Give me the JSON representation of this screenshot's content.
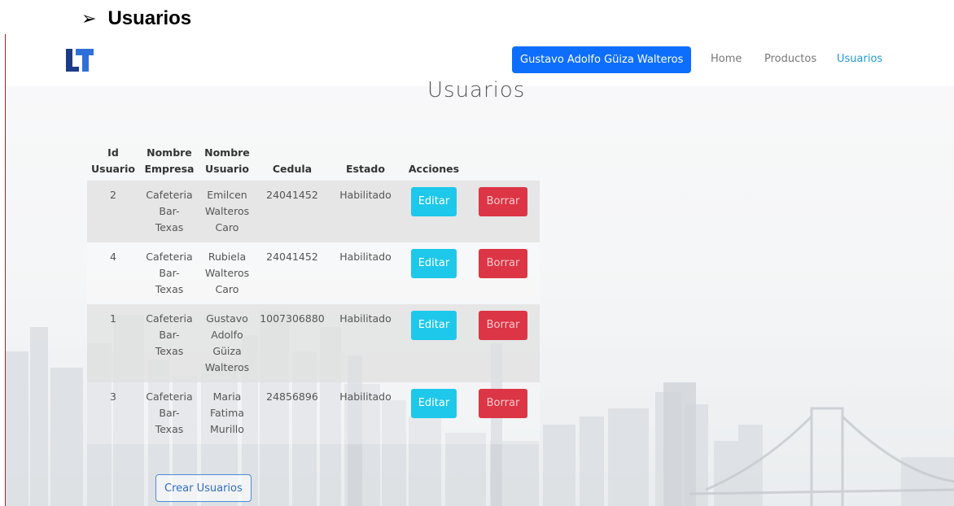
{
  "doc_heading": {
    "bullet": "➢",
    "text": "Usuarios"
  },
  "navbar": {
    "user_button": "Gustavo Adolfo Güiza Walteros",
    "links": [
      "Home",
      "Productos",
      "Usuarios"
    ]
  },
  "page_title": "Usuarios",
  "table": {
    "headers": {
      "id_line1": "Id",
      "id_line2": "Usuario",
      "empresa_line1": "Nombre",
      "empresa_line2": "Empresa",
      "usuario_line1": "Nombre",
      "usuario_line2": "Usuario",
      "cedula": "Cedula",
      "estado": "Estado",
      "acciones": "Acciones"
    },
    "rows": [
      {
        "id": "2",
        "empresa": [
          "Cafeteria",
          "Bar-",
          "Texas"
        ],
        "nombre": [
          "Emilcen",
          "Walteros",
          "Caro"
        ],
        "cedula": "24041452",
        "estado": "Habilitado"
      },
      {
        "id": "4",
        "empresa": [
          "Cafeteria",
          "Bar-",
          "Texas"
        ],
        "nombre": [
          "Rubiela",
          "Walteros",
          "Caro"
        ],
        "cedula": "24041452",
        "estado": "Habilitado"
      },
      {
        "id": "1",
        "empresa": [
          "Cafeteria",
          "Bar-",
          "Texas"
        ],
        "nombre": [
          "Gustavo",
          "Adolfo",
          "Güiza",
          "Walteros"
        ],
        "cedula": "1007306880",
        "estado": "Habilitado"
      },
      {
        "id": "3",
        "empresa": [
          "Cafeteria",
          "Bar-",
          "Texas"
        ],
        "nombre": [
          "Maria",
          "Fatima",
          "Murillo"
        ],
        "cedula": "24856896",
        "estado": "Habilitado"
      }
    ],
    "edit_label": "Editar",
    "delete_label": "Borrar"
  },
  "create_button": "Crear Usuarios",
  "colors": {
    "primary": "#0d6efd",
    "active_link": "#1f9bd6",
    "edit": "#1ec8ea",
    "delete": "#dc3545"
  },
  "icons": {
    "logo": "brand-logo-icon",
    "bullet": "arrow-bullet-icon"
  }
}
